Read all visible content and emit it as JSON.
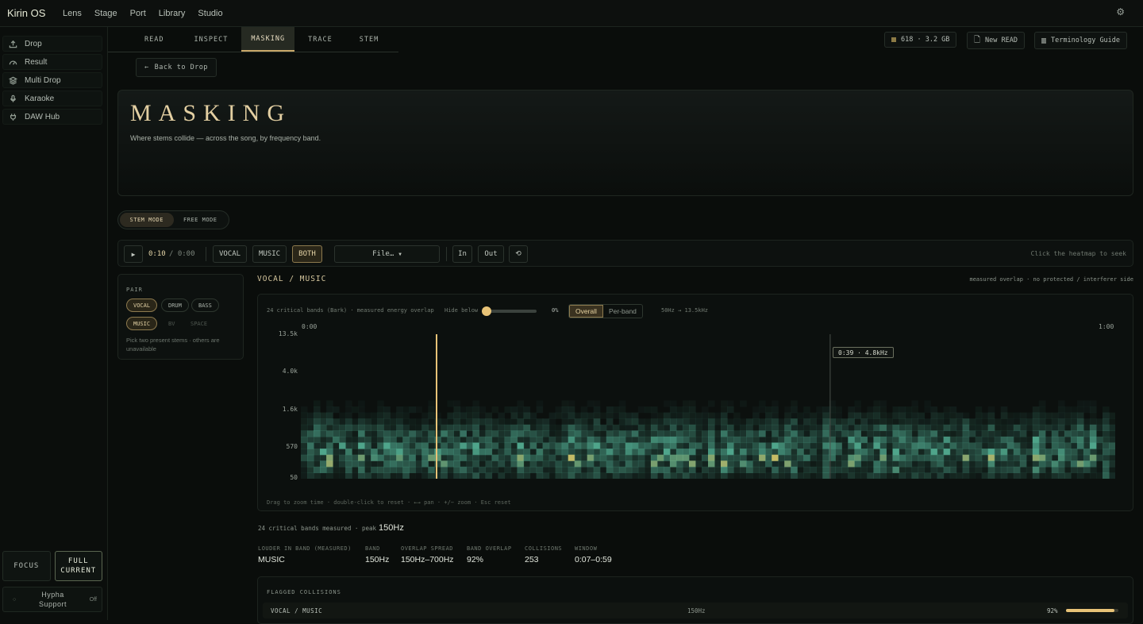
{
  "app": {
    "title": "Kirin OS"
  },
  "topnav": [
    "Lens",
    "Stage",
    "Port",
    "Library",
    "Studio"
  ],
  "topnav_active": 0,
  "sidebar": {
    "items": [
      {
        "label": "Drop",
        "icon": "upload-icon"
      },
      {
        "label": "Result",
        "icon": "gauge-icon"
      },
      {
        "label": "Multi Drop",
        "icon": "layers-icon"
      },
      {
        "label": "Karaoke",
        "icon": "microphone-icon"
      },
      {
        "label": "DAW Hub",
        "icon": "plug-icon"
      }
    ],
    "active": 1,
    "focus_label": "FOCUS",
    "full_current_line1": "FULL",
    "full_current_line2": "CURRENT",
    "hypha_line1": "Hypha",
    "hypha_line2": "Support",
    "hypha_state": "Off"
  },
  "tabs": [
    "READ",
    "INSPECT",
    "MASKING",
    "TRACE",
    "STEM"
  ],
  "tabs_active": 2,
  "toolbar": {
    "storage": "618 · 3.2 GB",
    "new_read": "New READ",
    "guide": "Terminology Guide"
  },
  "back_label": "Back to Drop",
  "hero": {
    "title": "MASKING",
    "subtitle": "Where stems collide — across the song, by frequency band."
  },
  "modes": [
    "STEM MODE",
    "FREE MODE"
  ],
  "mode_active": 0,
  "controls": {
    "current_time": "0:10",
    "duration": "/ 0:00",
    "views": [
      "VOCAL",
      "MUSIC",
      "BOTH"
    ],
    "view_active": 2,
    "file_label": "File…",
    "in_label": "In",
    "out_label": "Out",
    "hint": "Click the heatmap to seek"
  },
  "pair": {
    "label": "PAIR",
    "row1": [
      "VOCAL",
      "DRUM",
      "BASS"
    ],
    "row2": [
      "MUSIC",
      "BV",
      "SPACE"
    ],
    "note": "Pick two present stems · others are unavailable"
  },
  "pair_title": "VOCAL / MUSIC",
  "pair_sub": "measured overlap · no protected / interferer side",
  "heatmap": {
    "caption": "24 critical bands (Bark) · measured energy overlap",
    "hide_below_label": "Hide below",
    "hide_below_value": "0%",
    "hide_below_fraction": 0,
    "seg": [
      "Overall",
      "Per-band"
    ],
    "seg_active": 0,
    "range": "50Hz → 13.5kHz",
    "y_ticks": [
      "13.5k",
      "4.0k",
      "1.6k",
      "570",
      "50"
    ],
    "x_start": "0:00",
    "x_end": "1:00",
    "playhead_time_s": 10,
    "hover_time_s": 39,
    "hover_label": "0:39 · 4.8kHz",
    "hint": "Drag to zoom time · double-click to reset · ←→ pan · +/− zoom · Esc reset",
    "colors": {
      "low": "#1c3a33",
      "mid": "#4fa58b",
      "high": "#e8c25a",
      "playhead": "#e8c377"
    }
  },
  "peak": {
    "prefix": "24 critical bands measured · peak",
    "value": "150Hz"
  },
  "stats": [
    {
      "label": "LOUDER IN BAND (MEASURED)",
      "value": "MUSIC"
    },
    {
      "label": "BAND",
      "value": "150Hz"
    },
    {
      "label": "OVERLAP SPREAD",
      "value": "150Hz–700Hz"
    },
    {
      "label": "BAND OVERLAP",
      "value": "92%"
    },
    {
      "label": "COLLISIONS",
      "value": "253"
    },
    {
      "label": "WINDOW",
      "value": "0:07–0:59"
    }
  ],
  "flagged": {
    "title": "FLAGGED COLLISIONS",
    "rows": [
      {
        "pair": "VOCAL / MUSIC",
        "band": "150Hz",
        "overlap": "92%",
        "overlap_fraction": 0.92
      }
    ]
  }
}
